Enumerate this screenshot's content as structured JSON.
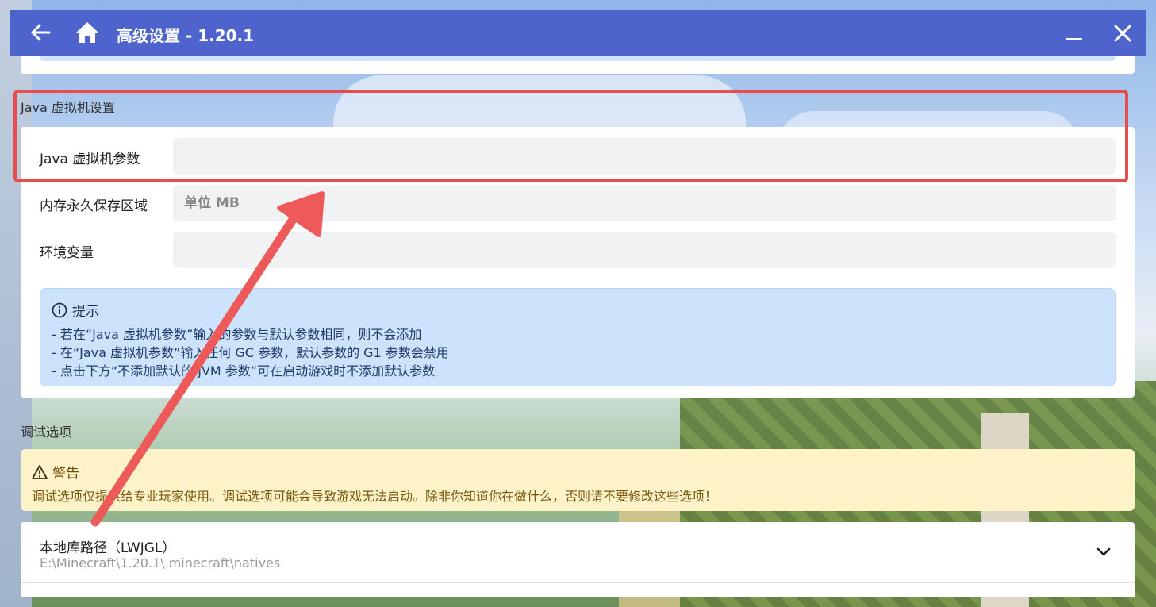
{
  "window": {
    "title": "高级设置 - 1.20.1"
  },
  "sections": {
    "jvm_title": "Java 虚拟机设置",
    "debug_title": "调试选项"
  },
  "jvm": {
    "fields": [
      {
        "label": "Java 虚拟机参数",
        "value": "",
        "placeholder": ""
      },
      {
        "label": "内存永久保存区域",
        "value": "",
        "placeholder": "单位 MB"
      },
      {
        "label": "环境变量",
        "value": "",
        "placeholder": ""
      }
    ]
  },
  "tip": {
    "title": "提示",
    "lines": [
      "- 若在“Java 虚拟机参数”输入的参数与默认参数相同，则不会添加",
      "- 在“Java 虚拟机参数”输入任何 GC 参数，默认参数的 G1 参数会禁用",
      "- 点击下方“不添加默认的 JVM 参数”可在启动游戏时不添加默认参数"
    ]
  },
  "warning": {
    "title": "警告",
    "text": "调试选项仅提供给专业玩家使用。调试选项可能会导致游戏无法启动。除非你知道你在做什么，否则请不要修改这些选项！"
  },
  "lwjgl": {
    "name": "本地库路径（LWJGL）",
    "path": "E:\\Minecraft\\1.20.1\\.minecraft\\natives"
  },
  "colors": {
    "titlebar": "#4f63cc",
    "highlight": "#e84d4d",
    "info_bg": "#cde3fb",
    "warn_bg": "#fdf2c8"
  }
}
